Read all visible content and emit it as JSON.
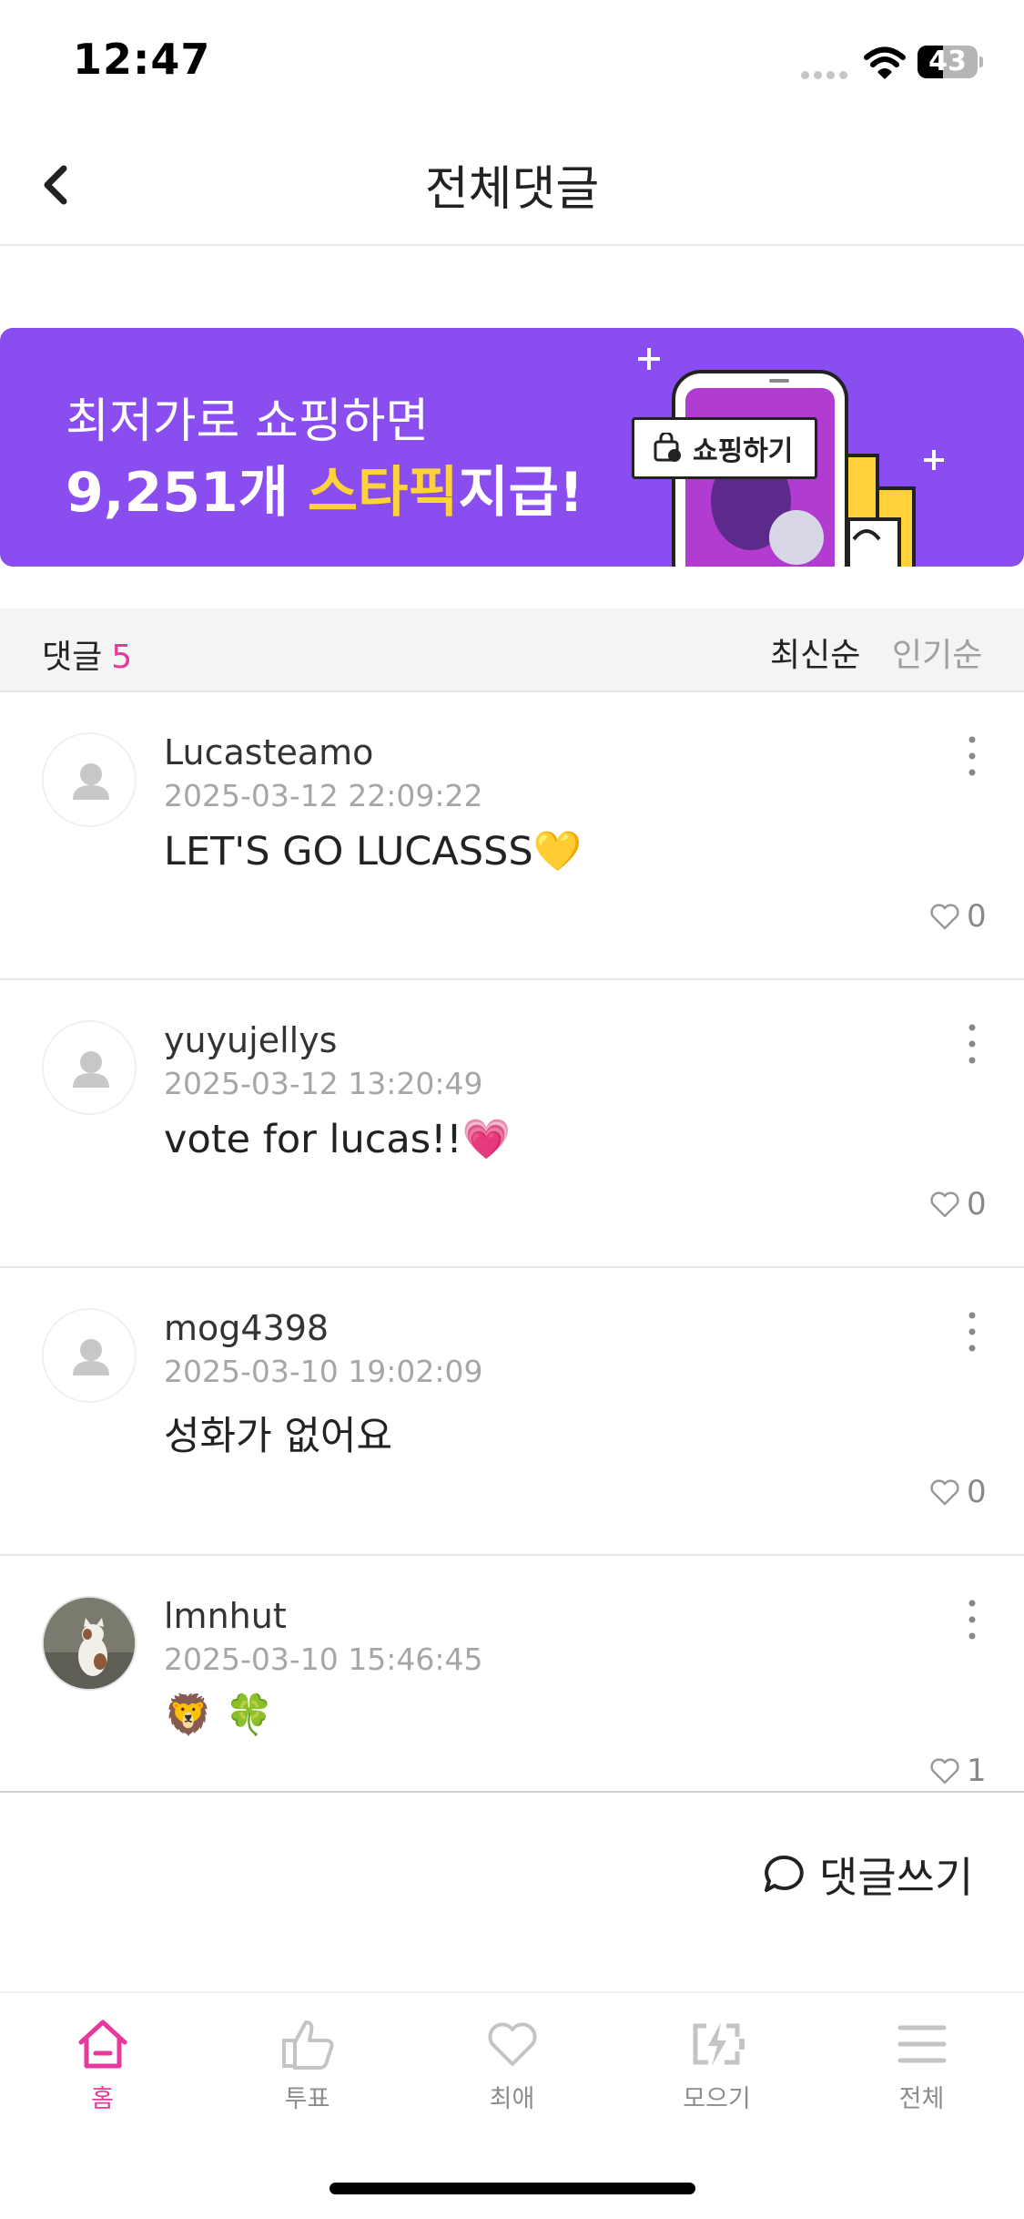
{
  "status_bar": {
    "time": "12:47",
    "battery": "43",
    "battery_level": 0.43
  },
  "header": {
    "title": "전체댓글",
    "back_icon": "chevron-left-icon"
  },
  "banner": {
    "line1": "최저가로 쇼핑하면",
    "line2_prefix": "9,251개 ",
    "line2_highlight": "스타픽",
    "line2_suffix": "지급!",
    "chip_label": "쇼핑하기",
    "background_color": "#8a4df0",
    "highlight_color": "#ffd23a"
  },
  "comments_header": {
    "label": "댓글",
    "count": "5",
    "sort_latest": "최신순",
    "sort_popular": "인기순",
    "count_color": "#e8389c"
  },
  "comments": [
    {
      "author": "Lucasteamo",
      "date": "2025-03-12 22:09:22",
      "text": "LET'S GO LUCASSS💛",
      "likes": "0",
      "avatar": "default-user-avatar"
    },
    {
      "author": "yuyujellys",
      "date": "2025-03-12 13:20:49",
      "text": "vote for lucas!!💗",
      "likes": "0",
      "avatar": "default-user-avatar"
    },
    {
      "author": "mog4398",
      "date": "2025-03-10 19:02:09",
      "text": "성화가 없어요",
      "likes": "0",
      "avatar": "default-user-avatar"
    },
    {
      "author": "lmnhut",
      "date": "2025-03-10 15:46:45",
      "text": "🦁 🍀",
      "likes": "1",
      "avatar": "cat-photo-avatar"
    }
  ],
  "write_comment": {
    "label": "댓글쓰기",
    "icon": "speech-bubble-icon"
  },
  "bottom_nav": {
    "items": [
      {
        "label": "홈",
        "icon": "home-icon",
        "active": true
      },
      {
        "label": "투표",
        "icon": "thumbs-up-icon",
        "active": false
      },
      {
        "label": "최애",
        "icon": "heart-icon",
        "active": false
      },
      {
        "label": "모으기",
        "icon": "battery-charge-icon",
        "active": false
      },
      {
        "label": "전체",
        "icon": "menu-icon",
        "active": false
      }
    ],
    "active_color": "#e8389c",
    "inactive_color": "#8c8c8c"
  }
}
